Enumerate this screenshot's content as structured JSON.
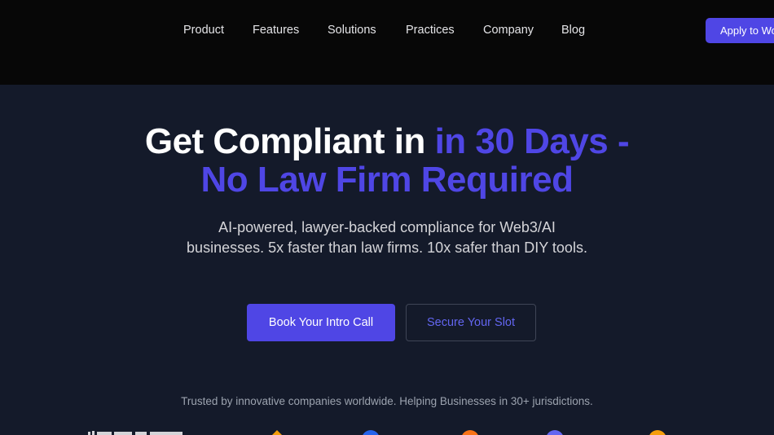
{
  "nav": {
    "items": [
      {
        "label": "Product"
      },
      {
        "label": "Features"
      },
      {
        "label": "Solutions"
      },
      {
        "label": "Practices"
      },
      {
        "label": "Company"
      },
      {
        "label": "Blog"
      }
    ],
    "apply_label": "Apply to Wo"
  },
  "hero": {
    "headline_white": "Get Compliant in ",
    "headline_accent_1": "in 30 Days -",
    "headline_accent_2": "No Law Firm Required",
    "subtext": "AI-powered, lawyer-backed compliance for Web3/AI businesses. 5x faster than law firms. 10x safer than DIY tools.",
    "primary_cta": "Book Your Intro Call",
    "secondary_cta": "Secure Your Slot"
  },
  "trusted_text": "Trusted by innovative companies worldwide. Helping Businesses in 30+ jurisdictions.",
  "colors": {
    "accent": "#4f46e5",
    "topbar_bg": "#070707",
    "hero_bg": "#141a2a"
  }
}
